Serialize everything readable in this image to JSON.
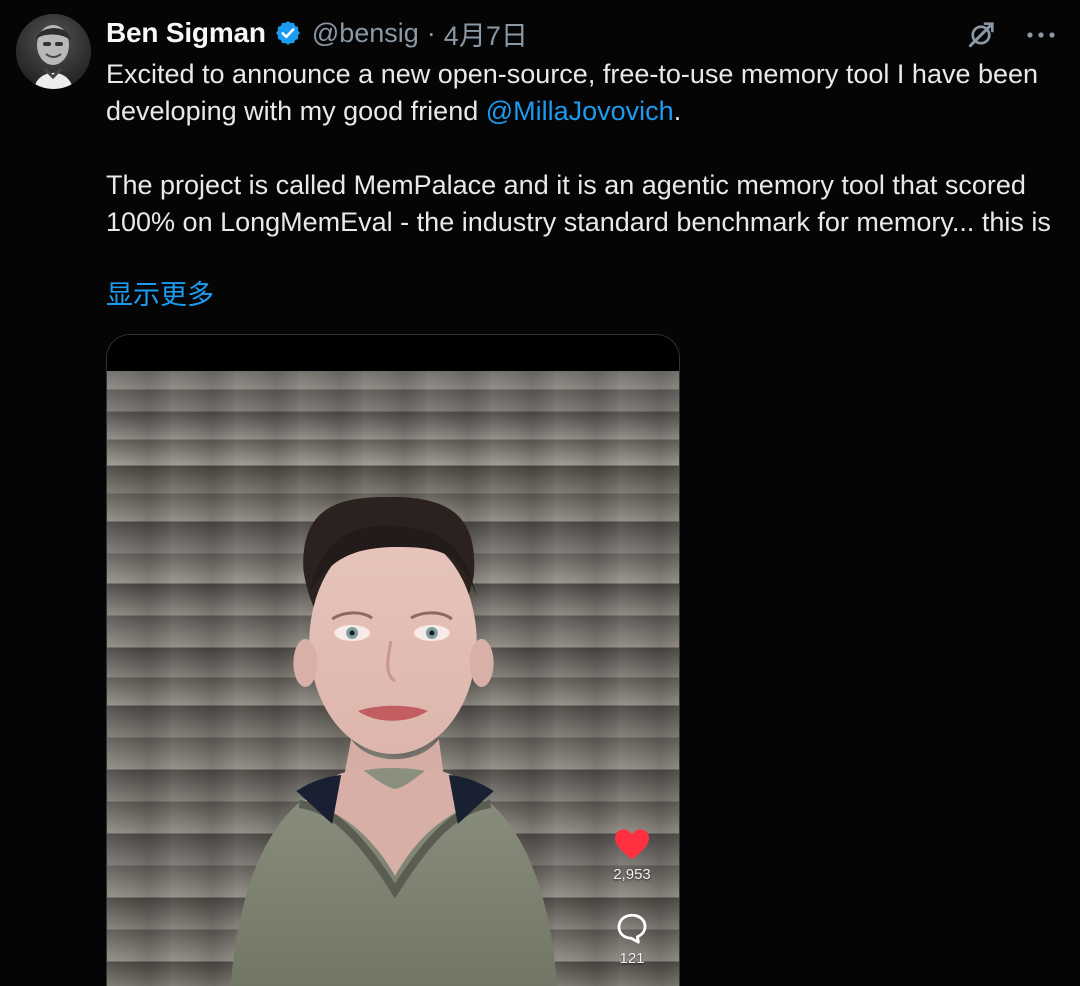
{
  "author": {
    "display_name": "Ben Sigman",
    "handle": "@bensig",
    "separator": "·",
    "date": "4月7日"
  },
  "tweet": {
    "paragraph_1": {
      "before_mention": "Excited to announce a new open-source, free-to-use memory tool I have been developing with my good friend ",
      "mention": "@MillaJovovich",
      "after_mention": "."
    },
    "paragraph_2": "The project is called MemPalace and it is an agentic memory tool that scored 100% on LongMemEval - the industry standard benchmark for memory... this is",
    "show_more": "显示更多"
  },
  "media": {
    "likes_count": "2,953",
    "comments_count": "121"
  },
  "icons": {
    "verified": "verified-badge-icon",
    "grok": "grok-icon",
    "more": "more-icon",
    "heart": "heart-icon",
    "comment": "comment-icon"
  },
  "colors": {
    "background": "#000000",
    "text_primary": "#e7e9ea",
    "text_secondary": "#8b98a5",
    "accent": "#1d9bf0",
    "heart": "#f91880"
  }
}
